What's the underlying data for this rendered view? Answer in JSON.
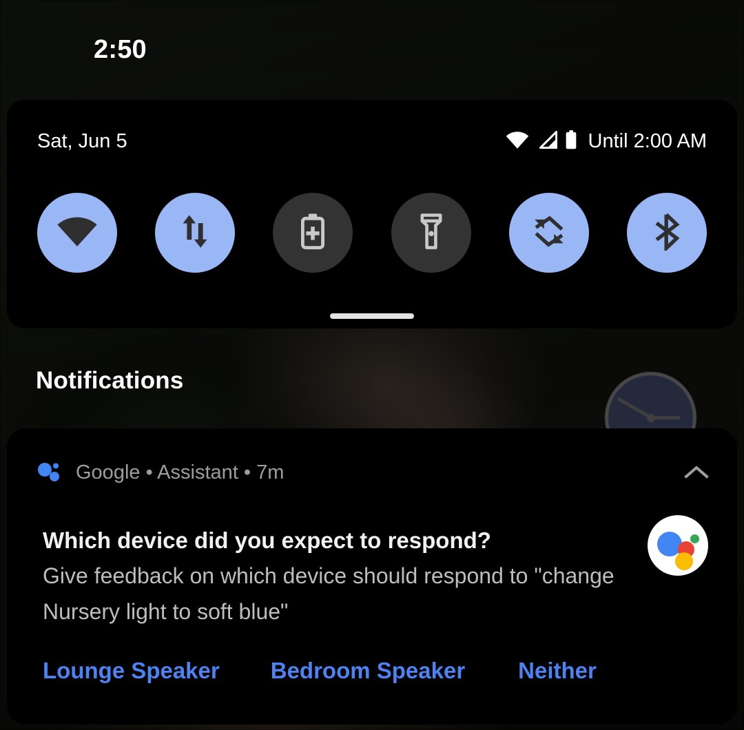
{
  "status_bar": {
    "clock": "2:50"
  },
  "quick_settings": {
    "date": "Sat, Jun 5",
    "dnd_text": "Until 2:00 AM",
    "status_icons": [
      {
        "name": "wifi-icon"
      },
      {
        "name": "cell-signal-icon"
      },
      {
        "name": "battery-icon"
      }
    ],
    "handle": "drag-handle",
    "tiles": [
      {
        "name": "wifi-tile",
        "label": "Wi-Fi",
        "icon": "wifi-icon",
        "state": "active"
      },
      {
        "name": "mobile-data-tile",
        "label": "Mobile data",
        "icon": "data-arrows-icon",
        "state": "active"
      },
      {
        "name": "battery-saver-tile",
        "label": "Battery Saver",
        "icon": "battery-plus-icon",
        "state": "inactive"
      },
      {
        "name": "flashlight-tile",
        "label": "Flashlight",
        "icon": "flashlight-icon",
        "state": "inactive"
      },
      {
        "name": "auto-rotate-tile",
        "label": "Auto-rotate",
        "icon": "rotate-icon",
        "state": "active"
      },
      {
        "name": "bluetooth-tile",
        "label": "Bluetooth",
        "icon": "bluetooth-icon",
        "state": "active"
      }
    ]
  },
  "notifications_section": {
    "title": "Notifications"
  },
  "notification": {
    "app_name": "Google",
    "channel": "Assistant",
    "time": "7m",
    "source_line": "Google • Assistant • 7m",
    "icon": "assistant-dots-icon",
    "collapse_icon": "chevron-up-icon",
    "title": "Which device did you expect to respond?",
    "body": "Give feedback on which device should respond to \"change Nursery light to soft blue\"",
    "avatar": "google-assistant-avatar",
    "actions": [
      {
        "name": "action-lounge-speaker",
        "label": "Lounge Speaker"
      },
      {
        "name": "action-bedroom-speaker",
        "label": "Bedroom Speaker"
      },
      {
        "name": "action-neither",
        "label": "Neither"
      }
    ]
  },
  "home_screen": {
    "clock_widget": "analog-clock-widget"
  },
  "colors": {
    "tile_active": "#9ab7f5",
    "tile_inactive": "#333333",
    "action_blue": "#4d82f3",
    "panel_bg": "#000000",
    "title_text": "#ffffff",
    "body_text": "#bdbdbd"
  }
}
